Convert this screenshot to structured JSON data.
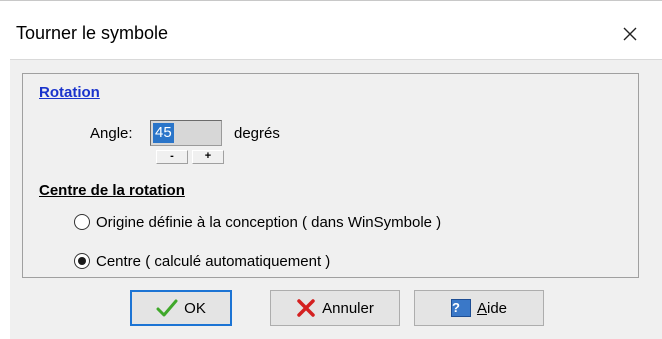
{
  "dialog": {
    "title": "Tourner le symbole",
    "close_symbol": "✕"
  },
  "rotation": {
    "heading": "Rotation",
    "angle_label": "Angle:",
    "angle_value": "45",
    "unit": "degrés",
    "decrement_label": "-",
    "increment_label": "+"
  },
  "centre": {
    "heading": "Centre de la rotation",
    "options": [
      {
        "label": "Origine définie à la conception ( dans WinSymbole )",
        "selected": false
      },
      {
        "label": "Centre ( calculé automatiquement )",
        "selected": true
      }
    ]
  },
  "buttons": {
    "ok": {
      "label": "OK",
      "icon": "checkmark-icon",
      "color": "#3fa82a"
    },
    "cancel": {
      "label": "Annuler",
      "icon": "red-x-icon",
      "color": "#d42020"
    },
    "help": {
      "label_underlined": "A",
      "label_rest": "ide",
      "icon": "help-icon",
      "icon_glyph": "?"
    }
  },
  "colors": {
    "section_heading": "#1a33cc",
    "selection": "#2a75c9",
    "focus_border": "#1c74d4"
  }
}
